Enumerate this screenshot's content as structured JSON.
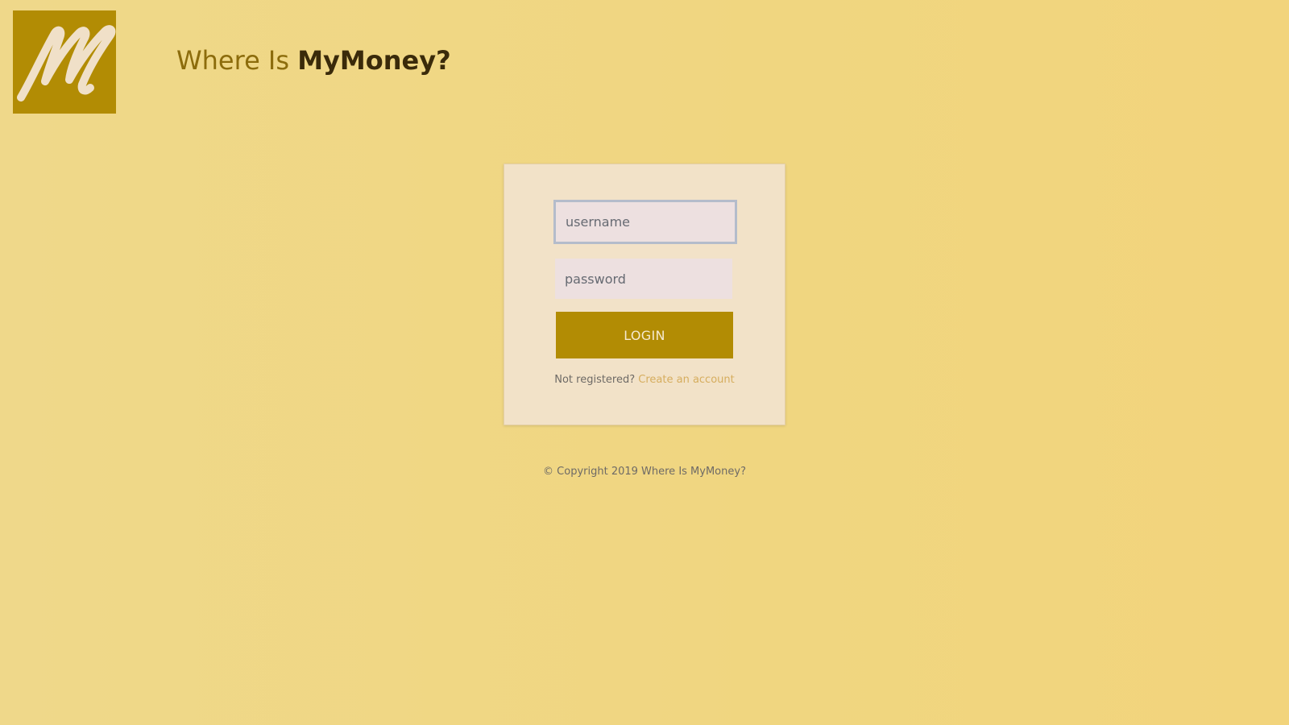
{
  "header": {
    "logo_icon": "script-m-logo",
    "logo_letter": "M",
    "title_prefix": "Where Is ",
    "title_brand": "MyMoney?"
  },
  "login_form": {
    "username_placeholder": "username",
    "password_placeholder": "password",
    "login_label": "LOGIN",
    "not_registered_text": "Not registered?",
    "create_account_label": "Create an account"
  },
  "footer": {
    "copyright": "© Copyright 2019 Where Is MyMoney?"
  },
  "colors": {
    "accent": "#b28c04",
    "background": "#efd88a",
    "card": "#f2e2c8",
    "input_bg": "#ede0e0",
    "link": "#d6ad5e",
    "title_dark": "#3a2a0a",
    "title_light": "#8c6c0c"
  }
}
